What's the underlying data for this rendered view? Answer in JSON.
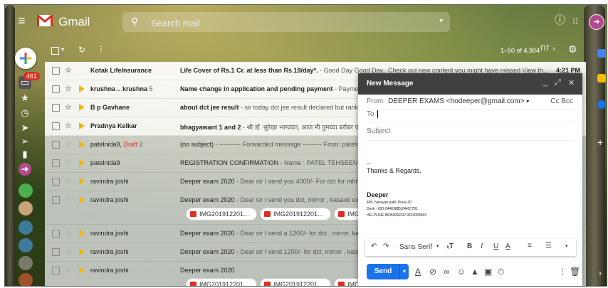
{
  "app": {
    "name": "Gmail"
  },
  "search": {
    "placeholder": "Search mail"
  },
  "rail": {
    "inbox_count": "461"
  },
  "toolbar": {
    "pager": "1–50 of 4,904"
  },
  "emails": [
    {
      "sender": "Kotak LifeInsurance",
      "draft": "",
      "count": "",
      "subject": "Life Cover of Rs.1 Cr. at less than Rs.19/day*.",
      "snippet": " - Good Day Good Day.. Check out new content you might have missed View th...",
      "time": "4:21 PM",
      "unread": true,
      "important": false,
      "attachments": []
    },
    {
      "sender": "krushna .. krushna",
      "draft": "",
      "count": "5",
      "subject": "Name change in application and pending payment",
      "snippet": " - Payment id",
      "time": "",
      "unread": true,
      "important": true,
      "attachments": []
    },
    {
      "sender": "B p Gavhane",
      "draft": "",
      "count": "",
      "subject": "about dct jee result",
      "snippet": " - sir today dct jee result declared but rank ar",
      "time": "",
      "unread": true,
      "important": true,
      "attachments": []
    },
    {
      "sender": "Pradnya Kelkar",
      "draft": "",
      "count": "",
      "subject": "bhagyawant 1 and 2",
      "snippet": " - श्री डॉ. सुरेखा भाग्यवंत, आज मी तुमच्या बरोबर ए",
      "time": "",
      "unread": true,
      "important": true,
      "attachments": []
    },
    {
      "sender": "patelnida9,",
      "draft": "Draft",
      "count": "2",
      "subject": "(no subject)",
      "snippet": " - ---------- Forwarded message --------- From: patelnida",
      "time": "",
      "unread": false,
      "important": true,
      "attachments": []
    },
    {
      "sender": "patelnida9",
      "draft": "",
      "count": "",
      "subject": "REGISTRATION CONFIRMATION",
      "snippet": " - Name : PATEL TEHSEEN MUS",
      "time": "",
      "unread": false,
      "important": true,
      "attachments": []
    },
    {
      "sender": "ravindra joshi",
      "draft": "",
      "count": "",
      "subject": "Deeper exam 2020",
      "snippet": " - Dear sir I send you 4000/- For dct for mht c",
      "time": "",
      "unread": false,
      "important": true,
      "attachments": []
    },
    {
      "sender": "ravindra joshi",
      "draft": "",
      "count": "",
      "subject": "Deeper exam 2020",
      "snippet": " - Dear sir I send you dct, mirror , kasauti exar",
      "time": "",
      "unread": false,
      "important": true,
      "attachments": [
        "IMG201912201...",
        "IMG201912201...",
        "IMG2"
      ]
    },
    {
      "sender": "ravindra joshi",
      "draft": "",
      "count": "",
      "subject": "Deeper exam 2020",
      "snippet": " - Dear sir I send a 1200/- for dct , mirror, kasi",
      "time": "",
      "unread": false,
      "important": true,
      "attachments": []
    },
    {
      "sender": "ravindra joshi",
      "draft": "",
      "count": "",
      "subject": "Deeper exam 2020",
      "snippet": " - Dear sir I send 1200/- for dct, mirror , kasut",
      "time": "",
      "unread": false,
      "important": true,
      "attachments": []
    },
    {
      "sender": "ravindra joshi",
      "draft": "",
      "count": "",
      "subject": "Deeper exam 2020",
      "snippet": "",
      "time": "",
      "unread": false,
      "important": true,
      "attachments": [
        "IMG201912201...",
        "IMG201912201...",
        "IMG2"
      ]
    }
  ],
  "compose": {
    "title": "New Message",
    "from_label": "From",
    "from_value": "DEEPER EXAMS <hodeeper@gmail.com>",
    "cc_bcc": "Cc Bcc",
    "to_label": "To",
    "subject_placeholder": "Subject",
    "sig_dashes": "--",
    "sig_regards": "Thanks & Regards,",
    "sig_name": "Deeper",
    "sig_addr": "495, Narayan path, Pune-30",
    "sig_desk": "Desk:-  020-24465885/24457781",
    "sig_help": "HELPLINE 8605009232/ 9623099563",
    "font_name": "Sans Serif",
    "send_label": "Send"
  }
}
